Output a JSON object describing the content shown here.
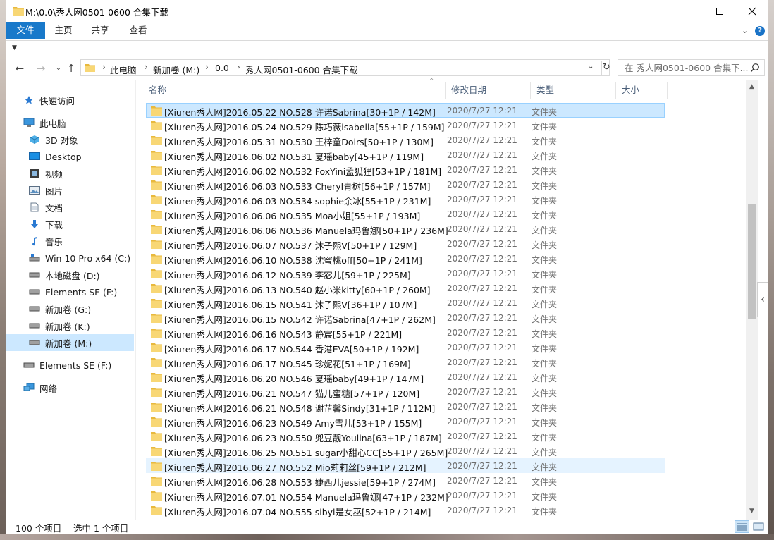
{
  "window": {
    "title": "M:\\0.0\\秀人网0501-0600 合集下载",
    "colors": {
      "accent": "#1979ca",
      "folder": "#f8d775",
      "selection": "#cce8ff"
    }
  },
  "ribbon": {
    "tabs": [
      "文件",
      "主页",
      "共享",
      "查看"
    ]
  },
  "address": {
    "crumbs": [
      "此电脑",
      "新加卷 (M:)",
      "0.0",
      "秀人网0501-0600 合集下载"
    ]
  },
  "search": {
    "placeholder": "在 秀人网0501-0600 合集下..."
  },
  "navpane": {
    "items": [
      {
        "label": "快速访问",
        "icon": "star-icon"
      },
      {
        "label": "此电脑",
        "icon": "computer-icon"
      },
      {
        "label": "3D 对象",
        "icon": "cube-icon"
      },
      {
        "label": "Desktop",
        "icon": "desktop-icon"
      },
      {
        "label": "视频",
        "icon": "film-icon"
      },
      {
        "label": "图片",
        "icon": "picture-icon"
      },
      {
        "label": "文档",
        "icon": "document-icon"
      },
      {
        "label": "下载",
        "icon": "download-icon"
      },
      {
        "label": "音乐",
        "icon": "music-icon"
      },
      {
        "label": "Win 10 Pro x64 (C:)",
        "icon": "system-drive-icon"
      },
      {
        "label": "本地磁盘 (D:)",
        "icon": "drive-icon"
      },
      {
        "label": "Elements SE (F:)",
        "icon": "drive-icon"
      },
      {
        "label": "新加卷 (G:)",
        "icon": "drive-icon"
      },
      {
        "label": "新加卷 (K:)",
        "icon": "drive-icon"
      },
      {
        "label": "新加卷 (M:)",
        "icon": "drive-icon"
      },
      {
        "label": "Elements SE (F:)",
        "icon": "drive-icon"
      },
      {
        "label": "网络",
        "icon": "network-icon"
      }
    ]
  },
  "columns": {
    "name": "名称",
    "date": "修改日期",
    "type": "类型",
    "size": "大小"
  },
  "files": [
    {
      "name": "[Xiuren秀人网]2016.05.22 NO.528 许诺Sabrina[30+1P / 142M]",
      "date": "2020/7/27 12:21",
      "type": "文件夹"
    },
    {
      "name": "[Xiuren秀人网]2016.05.24 NO.529 陈巧薇isabella[55+1P / 159M]",
      "date": "2020/7/27 12:21",
      "type": "文件夹"
    },
    {
      "name": "[Xiuren秀人网]2016.05.31 NO.530 王梓童Doirs[50+1P / 130M]",
      "date": "2020/7/27 12:21",
      "type": "文件夹"
    },
    {
      "name": "[Xiuren秀人网]2016.06.02 NO.531 夏瑶baby[45+1P / 119M]",
      "date": "2020/7/27 12:21",
      "type": "文件夹"
    },
    {
      "name": "[Xiuren秀人网]2016.06.02 NO.532 FoxYini孟狐狸[53+1P / 181M]",
      "date": "2020/7/27 12:21",
      "type": "文件夹"
    },
    {
      "name": "[Xiuren秀人网]2016.06.03 NO.533 Cheryl青树[56+1P / 157M]",
      "date": "2020/7/27 12:21",
      "type": "文件夹"
    },
    {
      "name": "[Xiuren秀人网]2016.06.03 NO.534 sophie余冰[55+1P / 231M]",
      "date": "2020/7/27 12:21",
      "type": "文件夹"
    },
    {
      "name": "[Xiuren秀人网]2016.06.06 NO.535 Moa小姐[55+1P / 193M]",
      "date": "2020/7/27 12:21",
      "type": "文件夹"
    },
    {
      "name": "[Xiuren秀人网]2016.06.06 NO.536 Manuela玛鲁娜[50+1P / 236M]",
      "date": "2020/7/27 12:21",
      "type": "文件夹"
    },
    {
      "name": "[Xiuren秀人网]2016.06.07 NO.537 沐子熙V[50+1P / 129M]",
      "date": "2020/7/27 12:21",
      "type": "文件夹"
    },
    {
      "name": "[Xiuren秀人网]2016.06.10 NO.538 沈蜜桃off[50+1P / 241M]",
      "date": "2020/7/27 12:21",
      "type": "文件夹"
    },
    {
      "name": "[Xiuren秀人网]2016.06.12 NO.539 李宓儿[59+1P / 225M]",
      "date": "2020/7/27 12:21",
      "type": "文件夹"
    },
    {
      "name": "[Xiuren秀人网]2016.06.13 NO.540 赵小米kitty[60+1P / 260M]",
      "date": "2020/7/27 12:21",
      "type": "文件夹"
    },
    {
      "name": "[Xiuren秀人网]2016.06.15 NO.541 沐子熙V[36+1P / 107M]",
      "date": "2020/7/27 12:21",
      "type": "文件夹"
    },
    {
      "name": "[Xiuren秀人网]2016.06.15 NO.542 许诺Sabrina[47+1P / 262M]",
      "date": "2020/7/27 12:21",
      "type": "文件夹"
    },
    {
      "name": "[Xiuren秀人网]2016.06.16 NO.543 静宸[55+1P / 221M]",
      "date": "2020/7/27 12:21",
      "type": "文件夹"
    },
    {
      "name": "[Xiuren秀人网]2016.06.17 NO.544 香港EVA[50+1P / 192M]",
      "date": "2020/7/27 12:21",
      "type": "文件夹"
    },
    {
      "name": "[Xiuren秀人网]2016.06.17 NO.545 珍妮花[51+1P / 169M]",
      "date": "2020/7/27 12:21",
      "type": "文件夹"
    },
    {
      "name": "[Xiuren秀人网]2016.06.20 NO.546 夏瑶baby[49+1P / 147M]",
      "date": "2020/7/27 12:21",
      "type": "文件夹"
    },
    {
      "name": "[Xiuren秀人网]2016.06.21 NO.547 猫儿蜜糖[57+1P / 120M]",
      "date": "2020/7/27 12:21",
      "type": "文件夹"
    },
    {
      "name": "[Xiuren秀人网]2016.06.21 NO.548 谢芷馨Sindy[31+1P / 112M]",
      "date": "2020/7/27 12:21",
      "type": "文件夹"
    },
    {
      "name": "[Xiuren秀人网]2016.06.23 NO.549 Amy雪儿[53+1P / 155M]",
      "date": "2020/7/27 12:21",
      "type": "文件夹"
    },
    {
      "name": "[Xiuren秀人网]2016.06.23 NO.550 兜豆靓Youlina[63+1P / 187M]",
      "date": "2020/7/27 12:21",
      "type": "文件夹"
    },
    {
      "name": "[Xiuren秀人网]2016.06.25 NO.551 sugar小甜心CC[55+1P / 265M]",
      "date": "2020/7/27 12:21",
      "type": "文件夹"
    },
    {
      "name": "[Xiuren秀人网]2016.06.27 NO.552 Mio莉莉丝[59+1P / 212M]",
      "date": "2020/7/27 12:21",
      "type": "文件夹"
    },
    {
      "name": "[Xiuren秀人网]2016.06.28 NO.553 婕西儿jessie[59+1P / 274M]",
      "date": "2020/7/27 12:21",
      "type": "文件夹"
    },
    {
      "name": "[Xiuren秀人网]2016.07.01 NO.554 Manuela玛鲁娜[47+1P / 232M]",
      "date": "2020/7/27 12:21",
      "type": "文件夹"
    },
    {
      "name": "[Xiuren秀人网]2016.07.04 NO.555 sibyl是女巫[52+1P / 214M]",
      "date": "2020/7/27 12:21",
      "type": "文件夹"
    }
  ],
  "status": {
    "count": "100 个项目",
    "selected": "选中 1 个项目"
  }
}
